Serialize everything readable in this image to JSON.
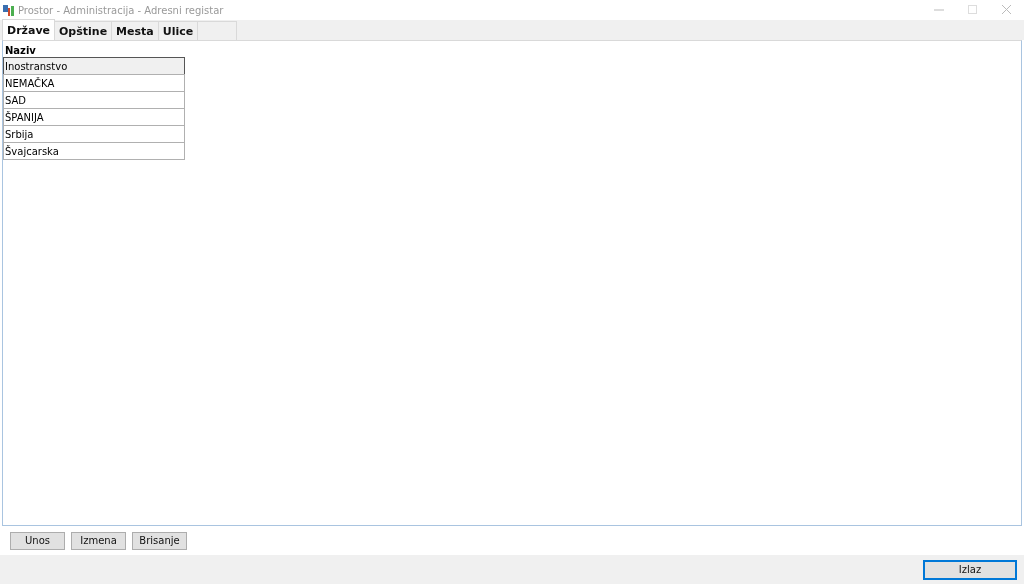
{
  "window": {
    "title": "Prostor - Administracija - Adresni registar"
  },
  "tabs": [
    {
      "label": "Države",
      "selected": true
    },
    {
      "label": "Opštine",
      "selected": false
    },
    {
      "label": "Mesta",
      "selected": false
    },
    {
      "label": "Ulice",
      "selected": false
    }
  ],
  "table": {
    "columns": [
      "Naziv"
    ],
    "rows": [
      {
        "cells": [
          "Inostranstvo"
        ],
        "selected": true
      },
      {
        "cells": [
          "NEMAČKA"
        ],
        "selected": false
      },
      {
        "cells": [
          "SAD"
        ],
        "selected": false
      },
      {
        "cells": [
          "ŠPANIJA"
        ],
        "selected": false
      },
      {
        "cells": [
          "Srbija"
        ],
        "selected": false
      },
      {
        "cells": [
          "Švajcarska"
        ],
        "selected": false
      }
    ]
  },
  "actions": [
    "Unos",
    "Izmena",
    "Brisanje"
  ],
  "footer_button": {
    "label": "Izlaz"
  }
}
